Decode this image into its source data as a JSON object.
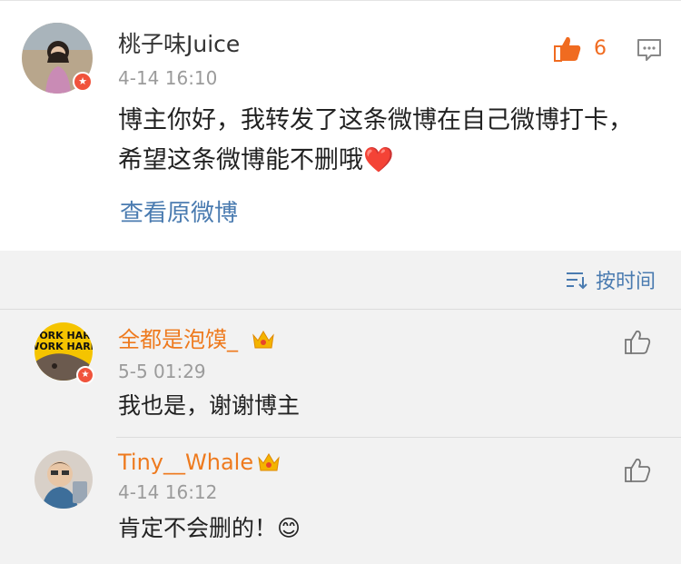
{
  "post": {
    "author": "桃子味Juice",
    "time": "4-14 16:10",
    "text": "博主你好，我转发了这条微博在自己微博打卡，希望这条微博能不删哦❤️",
    "likes": "6",
    "view_original": "查看原微博"
  },
  "sort": {
    "label": "按时间"
  },
  "replies": [
    {
      "author": "全都是泡馍_",
      "time": "5-5 01:29",
      "text": "我也是，谢谢博主"
    },
    {
      "author": "Tiny__Whale",
      "time": "4-14 16:12",
      "text": "肯定不会删的！😊"
    }
  ],
  "colors": {
    "accent": "#f06b20",
    "link": "#4a7bb0",
    "reply_name": "#ee7a1e",
    "badge": "#f0533c"
  },
  "icons": [
    "thumbs-up-icon",
    "comment-icon",
    "sort-icon",
    "vip-crown-icon"
  ]
}
